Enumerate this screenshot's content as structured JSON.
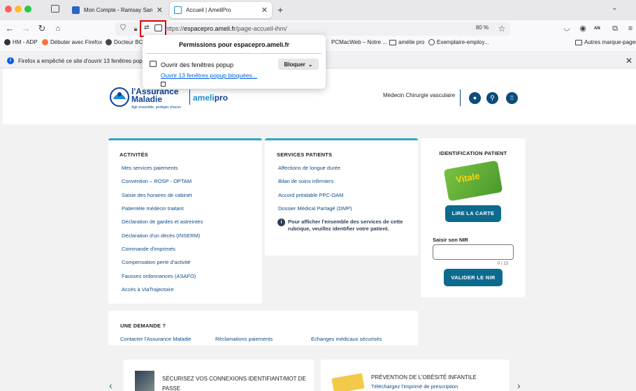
{
  "browser": {
    "tabs": [
      {
        "title": "Mon Compte - Ramsay Santé -",
        "active": false
      },
      {
        "title": "Accueil | AmeliPro",
        "active": true
      }
    ],
    "new_tab_symbol": "+",
    "url_prefix": "https://",
    "url_domain": "espacepro.ameli.fr",
    "url_path": "/page-accueil-ihm/",
    "zoom": "80 %",
    "bookmarks": [
      "HM - ADP",
      "Débuter avec Firefox",
      "Docteur BC",
      "PCMacWeb – Notre ...",
      "amélie pro",
      "Exemplaire-employ...",
      "Autres marque-pages"
    ],
    "notification": "Firefox a empêché ce site d'ouvrir 13 fenêtres popup"
  },
  "permissions_popup": {
    "title": "Permissions pour espacepro.ameli.fr",
    "row_label": "Ouvrir des fenêtres popup",
    "select_value": "Bloquer",
    "link": "Ouvrir 13 fenêtres popup bloquées..."
  },
  "site": {
    "logo_line1": "l'Assurance",
    "logo_line2": "Maladie",
    "logo_tagline": "Agir ensemble, protéger chacun",
    "product_ameli": "ameli",
    "product_pro": "pro",
    "role": "Médecin Chirurgie vasculaire"
  },
  "activites": {
    "title": "ACTIVITÉS",
    "items": [
      "Mes services paiements",
      "Convention – ROSP - OPTAM",
      "Saisie des horaires de cabinet",
      "Patientèle médecin traitant",
      "Déclaration de gardes et astreintes",
      "Déclaration d'un décès (INSERM)",
      "Commande d'imprimés",
      "Compensation perte d'activité",
      "Fausses ordonnances (ASAFO)",
      "Accès à ViaTrajectoire"
    ]
  },
  "services_patients": {
    "title": "SERVICES PATIENTS",
    "items": [
      "Affections de longue durée",
      "Bilan de soins infirmiers",
      "Accord préalable PPC-OAM",
      "Dossier Médical Partagé (DMP)"
    ],
    "info": "Pour afficher l'ensemble des services de cette rubrique, veuillez identifier votre patient."
  },
  "identification": {
    "title": "IDENTIFICATION PATIENT",
    "card_text": "Vitale",
    "read_card": "LIRE LA CARTE",
    "nir_label": "Saisir son NIR",
    "nir_value": "",
    "nir_count": "0 / 13",
    "validate": "VALIDER LE NIR"
  },
  "demande": {
    "title": "UNE DEMANDE ?",
    "links": [
      "Contacter l'Assurance Maladie",
      "Réclamations paiements",
      "Echanges médicaux sécurisés"
    ]
  },
  "promos": [
    {
      "title": "SÉCURISEZ VOS CONNEXIONS IDENTIFIANT/MOT DE PASSE"
    },
    {
      "title": "PRÉVENTION DE L'OBÉSITÉ INFANTILE",
      "sub": "Téléchargez l'imprimé de prescription"
    }
  ],
  "colors": {
    "accent": "#2aa6c9",
    "button": "#0c6a8e",
    "brand": "#0c419a",
    "popup_highlight": "#e00000"
  }
}
